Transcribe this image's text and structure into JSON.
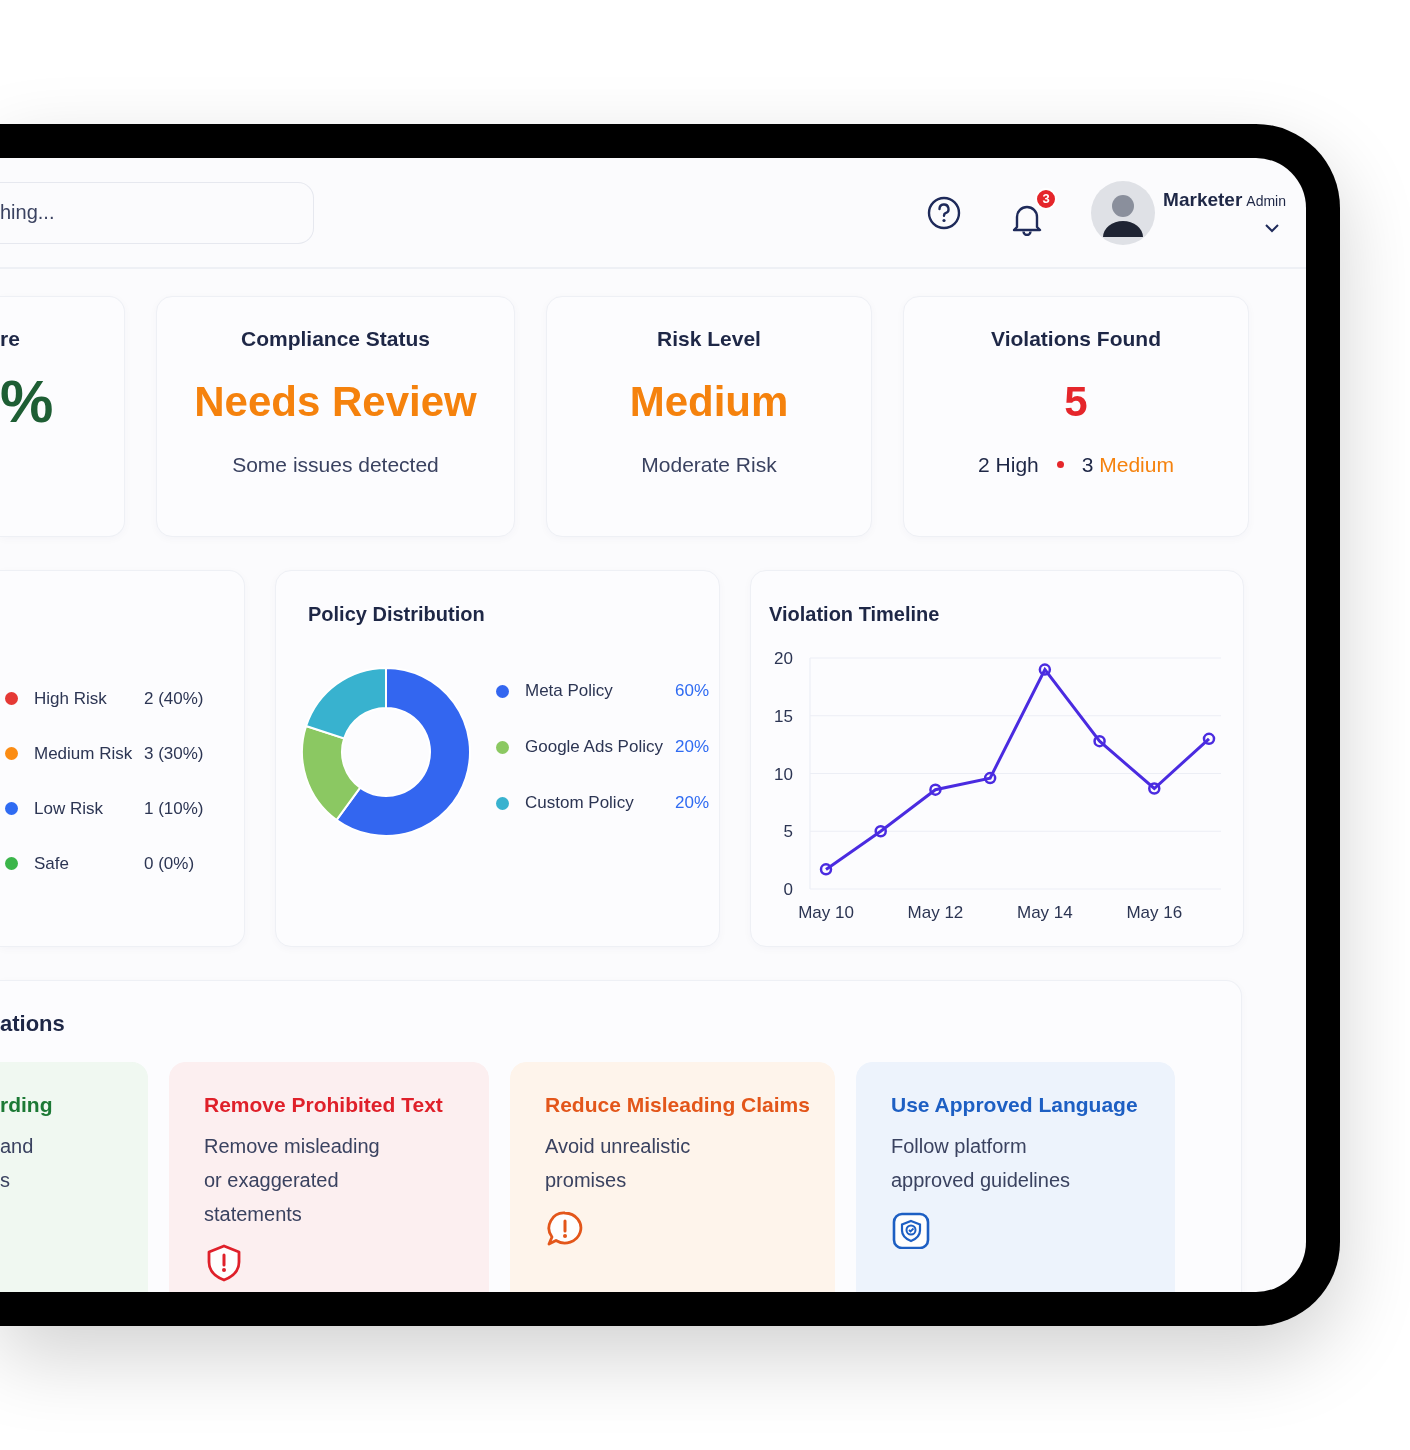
{
  "header": {
    "search": {
      "placeholder": "hing..."
    },
    "notifications": {
      "count": "3"
    },
    "user": {
      "name": "Marketer",
      "role": "Admin"
    }
  },
  "stat_cards": [
    {
      "title": "re",
      "value": "%",
      "color": "#1e5e34",
      "partial": true
    },
    {
      "title": "Compliance Status",
      "value": "Needs Review",
      "color": "#f5820d",
      "subtitle": "Some issues detected"
    },
    {
      "title": "Risk Level",
      "value": "Medium",
      "color": "#f5820d",
      "subtitle": "Moderate Risk"
    },
    {
      "title": "Violations Found",
      "value": "5",
      "color": "#e5262b",
      "breakdown": [
        {
          "count": "2",
          "label": "High"
        },
        {
          "count": "3",
          "label": "Medium",
          "color": "#f5820d"
        }
      ]
    }
  ],
  "risk_breakdown": {
    "items": [
      {
        "label": "High Risk",
        "value": "2 (40%)",
        "color": "#e53935"
      },
      {
        "label": "Medium Risk",
        "value": "3 (30%)",
        "color": "#fb8c14"
      },
      {
        "label": "Low Risk",
        "value": "1 (10%)",
        "color": "#2f6bf2"
      },
      {
        "label": "Safe",
        "value": "0 (0%)",
        "color": "#3bb54a"
      }
    ]
  },
  "policy_distribution": {
    "title": "Policy Distribution",
    "legend": [
      {
        "percent": "60%",
        "color": "#3366f0"
      },
      {
        "percent": "20%",
        "color": "#8bc862"
      },
      {
        "percent": "20%",
        "color": "#38b2cf"
      }
    ],
    "chart_data": {
      "type": "donut",
      "categories": [
        "Meta Policy",
        "Google Ads Policy",
        "Custom Policy"
      ],
      "values": [
        60,
        20,
        20
      ]
    }
  },
  "violation_timeline": {
    "title": "Violation Timeline",
    "chart_data": {
      "type": "line",
      "categories": [
        "May 10",
        null,
        "May 12",
        null,
        "May 14",
        null,
        "May 16",
        null
      ],
      "series": [
        {
          "color": "#4a2be0",
          "marker": "o",
          "values": [
            1.7,
            5,
            8.6,
            9.6,
            19,
            12.8,
            8.7,
            13
          ]
        }
      ],
      "ylim": [
        0,
        20
      ],
      "yticks": [
        0,
        5,
        10,
        15,
        20
      ],
      "grid": true
    }
  },
  "recommendations": {
    "title": "ations",
    "items": [
      {
        "kind": "none",
        "title": "rding",
        "lines": [
          "and",
          "s"
        ],
        "color": "#1c7a35",
        "partial": true
      },
      {
        "kind": "shield-alert",
        "title": "Remove Prohibited Text",
        "lines": [
          "Remove misleading",
          "or exaggerated",
          "statements"
        ],
        "color": "#e0202a"
      },
      {
        "kind": "chat-alert",
        "title": "Reduce Misleading Claims",
        "lines": [
          "Avoid unrealistic",
          "promises"
        ],
        "color": "#e4561a"
      },
      {
        "kind": "shield-check",
        "title": "Use Approved Language",
        "lines": [
          "Follow platform",
          "approved guidelines"
        ],
        "color": "#1d5fc4"
      }
    ]
  }
}
